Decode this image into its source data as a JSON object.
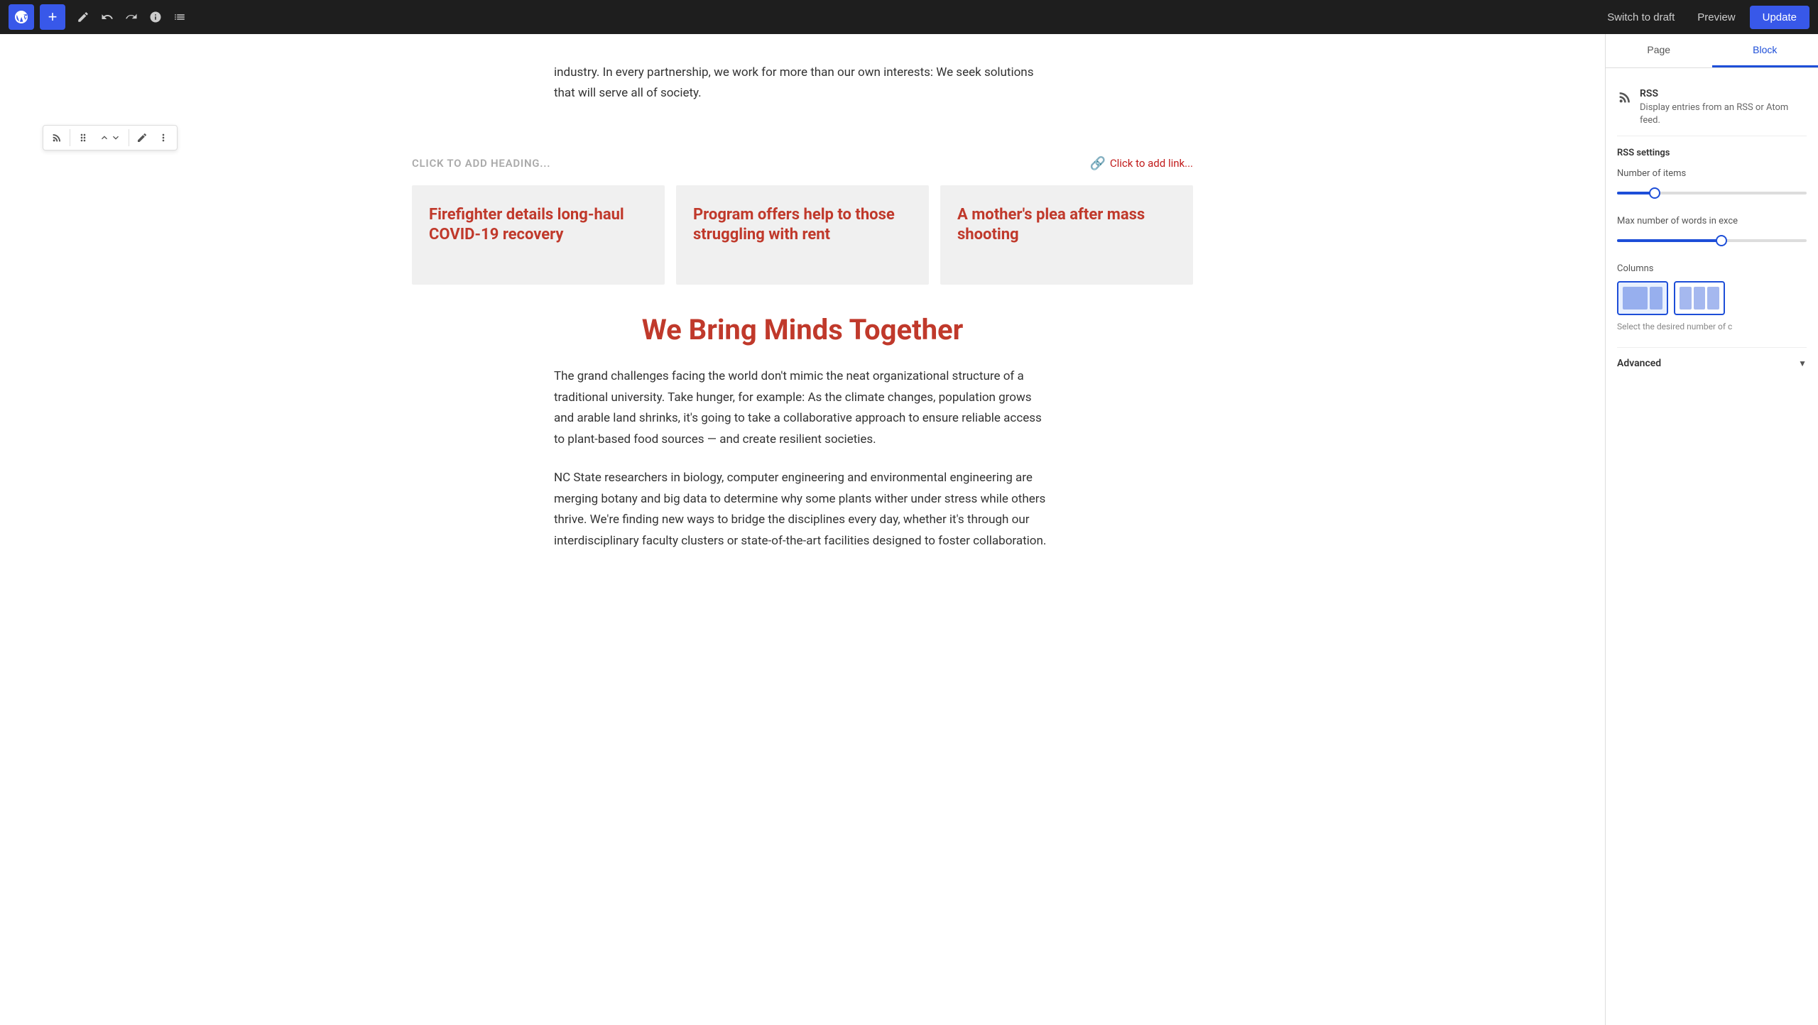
{
  "toolbar": {
    "add_label": "+",
    "switch_draft_label": "Switch to draft",
    "preview_label": "Preview",
    "update_label": "Update"
  },
  "editor": {
    "intro_text": "industry. In every partnership, we work for more than our own interests: We seek solutions that will serve all of society.",
    "heading_placeholder": "CLICK TO ADD HEADING...",
    "add_link_label": "Click to add link...",
    "rss_cards": [
      {
        "title": "Firefighter details long-haul COVID-19 recovery"
      },
      {
        "title": "Program offers help to those struggling with rent"
      },
      {
        "title": "A mother's plea after mass shooting"
      }
    ],
    "section_heading": "We Bring Minds Together",
    "body_paragraph_1": "The grand challenges facing the world don't mimic the neat organizational structure of a traditional university. Take hunger, for example: As the climate changes, population grows and arable land shrinks, it's going to take a collaborative approach to ensure reliable access to plant-based food sources — and create resilient societies.",
    "body_paragraph_2": "NC State researchers in biology, computer engineering and environmental engineering are merging botany and big data to determine why some plants wither under stress while others thrive. We're finding new ways to bridge the disciplines every day, whether it's through our interdisciplinary faculty clusters or state-of-the-art facilities designed to foster collaboration."
  },
  "sidebar": {
    "tab_page_label": "Page",
    "tab_block_label": "Block",
    "rss_block_title": "RSS",
    "rss_block_desc": "Display entries from an RSS or Atom feed.",
    "rss_settings_title": "RSS settings",
    "number_of_items_label": "Number of items",
    "max_words_label": "Max number of words in exce",
    "columns_label": "Columns",
    "columns_desc": "Select the desired number of c",
    "advanced_label": "Advanced",
    "slider1_value": 1,
    "slider2_value": 3
  }
}
